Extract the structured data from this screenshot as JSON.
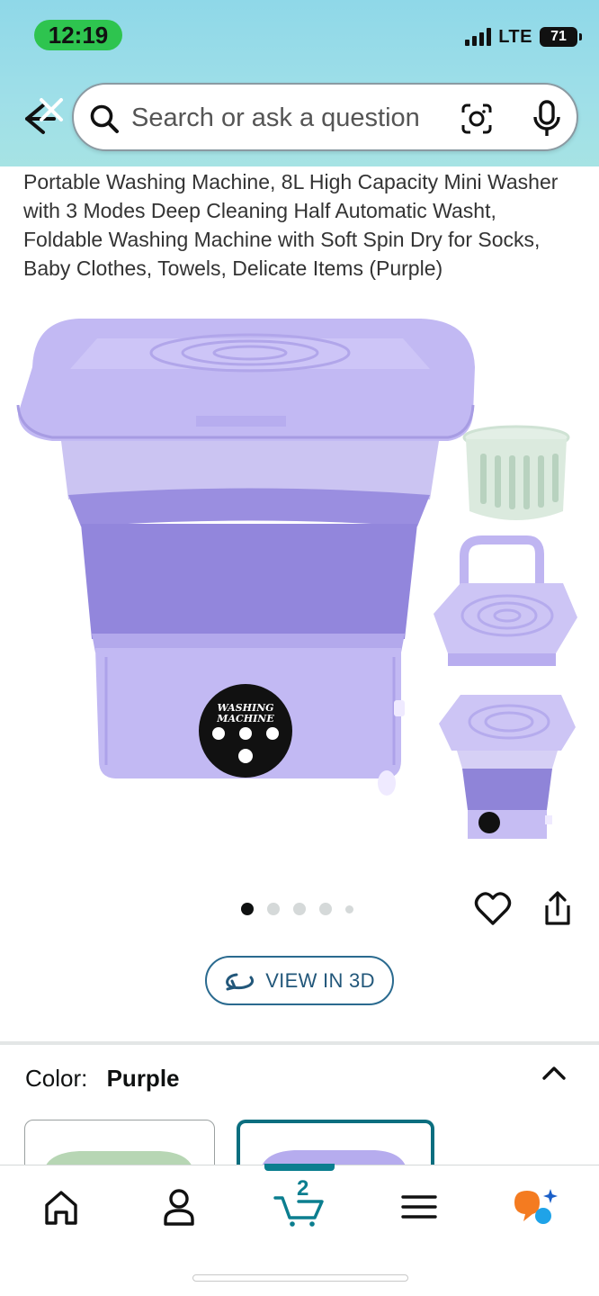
{
  "status_bar": {
    "time": "12:19",
    "network": "LTE",
    "battery": "71"
  },
  "search": {
    "placeholder": "Search or ask a question"
  },
  "product": {
    "title": "Portable Washing Machine, 8L High Capacity Mini Washer with 3 Modes Deep Cleaning Half Automatic Washt, Foldable Washing Machine with Soft Spin Dry for Socks, Baby Clothes, Towels, Delicate Items (Purple)",
    "device_label_line1": "WASHING",
    "device_label_line2": "MACHINE",
    "image_count": 5,
    "active_image": 1
  },
  "actions": {
    "view_3d": "VIEW IN 3D"
  },
  "color": {
    "label": "Color:",
    "value": "Purple"
  },
  "bottom_nav": {
    "cart_count": "2"
  },
  "colors": {
    "header_bg": "#9fdfe8",
    "purple": "#b3a7ec",
    "accent": "#0b7e8f",
    "time_pill": "#2ec44f"
  }
}
